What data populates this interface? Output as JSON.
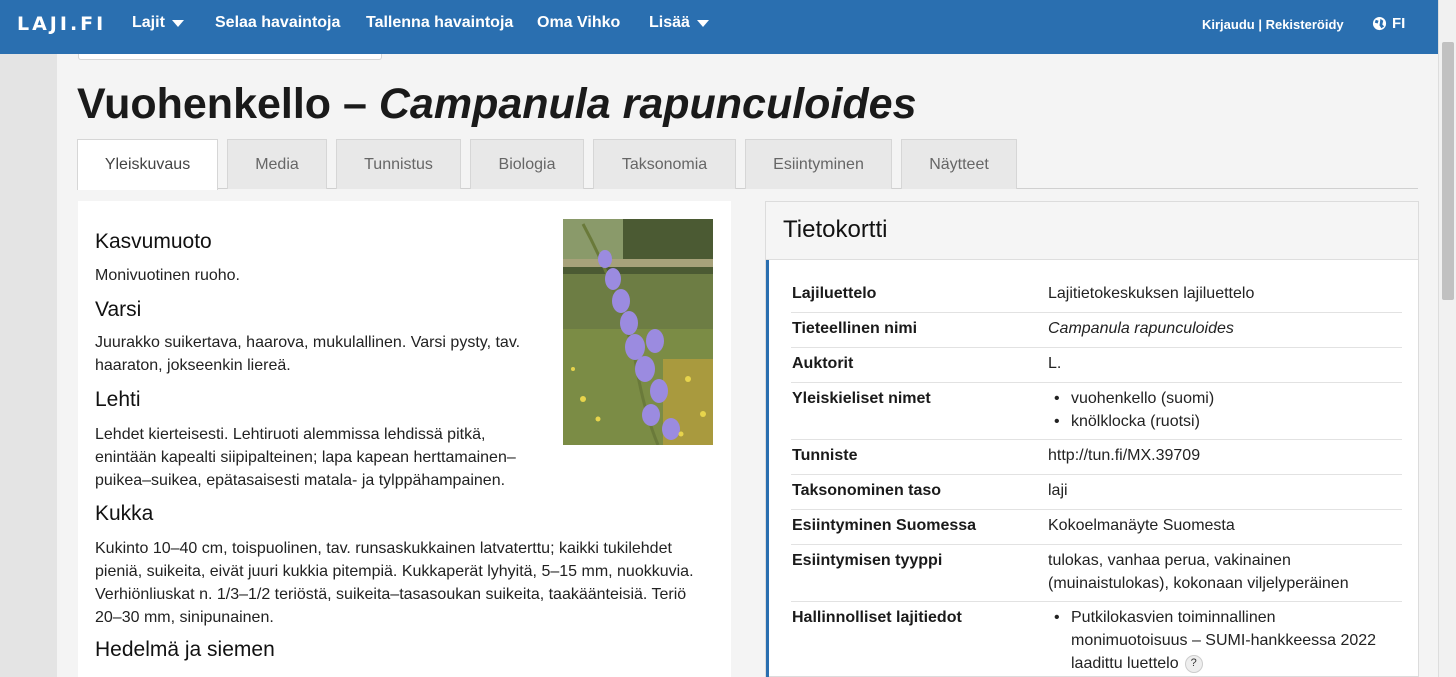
{
  "nav": {
    "brand": "LAJI.FI",
    "items": [
      "Lajit",
      "Selaa havaintoja",
      "Tallenna havaintoja",
      "Oma Vihko",
      "Lisää"
    ],
    "login": "Kirjaudu | Rekisteröidy",
    "lang": "FI"
  },
  "title": {
    "common": "Vuohenkello – ",
    "scientific": "Campanula rapunculoides"
  },
  "tabs": [
    "Yleiskuvaus",
    "Media",
    "Tunnistus",
    "Biologia",
    "Taksonomia",
    "Esiintyminen",
    "Näytteet"
  ],
  "description": {
    "h1": "Kasvumuoto",
    "p1": "Monivuotinen ruoho.",
    "h2": "Varsi",
    "p2a": "Juurakko suikertava, haarova, mukulallinen. Varsi pysty, tav.",
    "p2b": "haaraton, jokseenkin liereä.",
    "h3": "Lehti",
    "p3a": "Lehdet kierteisesti. Lehtiruoti alemmissa lehdissä pitkä,",
    "p3b": "enintään kapealti siipipalteinen; lapa kapean herttamainen–",
    "p3c": "puikea–suikea, epätasaisesti matala- ja tylppähampainen.",
    "h4": "Kukka",
    "p4a": "Kukinto 10–40 cm, toispuolinen, tav. runsaskukkainen latvaterttu; kaikki tukilehdet",
    "p4b": "pieniä, suikeita, eivät juuri kukkia pitempiä. Kukkaperät lyhyitä, 5–15 mm, nuokkuvia.",
    "p4c": "Verhiönliuskat n. 1/3–1/2 teriöstä, suikeita–tasasoukan suikeita, taakäänteisiä. Teriö",
    "p4d": "20–30 mm, sinipunainen.",
    "h5": "Hedelmä ja siemen"
  },
  "card": {
    "title": "Tietokortti",
    "rows": [
      {
        "label": "Lajiluettelo",
        "value": "Lajitietokeskuksen lajiluettelo"
      },
      {
        "label": "Tieteellinen nimi",
        "value": "Campanula rapunculoides"
      },
      {
        "label": "Auktorit",
        "value": "L."
      },
      {
        "label": "Yleiskieliset nimet",
        "values": [
          "vuohenkello (suomi)",
          "knölklocka (ruotsi)"
        ]
      },
      {
        "label": "Tunniste",
        "value": "http://tun.fi/MX.39709"
      },
      {
        "label": "Taksonominen taso",
        "value": "laji"
      },
      {
        "label": "Esiintyminen Suomessa",
        "value": "Kokoelmanäyte Suomesta"
      },
      {
        "label": "Esiintymisen tyyppi",
        "value_a": "tulokas, vanhaa perua, vakinainen",
        "value_b": "(muinaistulokas), kokonaan viljelyperäinen"
      },
      {
        "label": "Hallinnolliset lajitiedot",
        "bullet_a": "Putkilokasvien toiminnallinen",
        "bullet_b": "monimuotoisuus – SUMI-hankkeessa 2022",
        "bullet_c": "laadittu luettelo",
        "help": "?"
      }
    ]
  },
  "colors": {
    "navbar": "#2a6fb0",
    "accent": "#2a6fb0"
  }
}
